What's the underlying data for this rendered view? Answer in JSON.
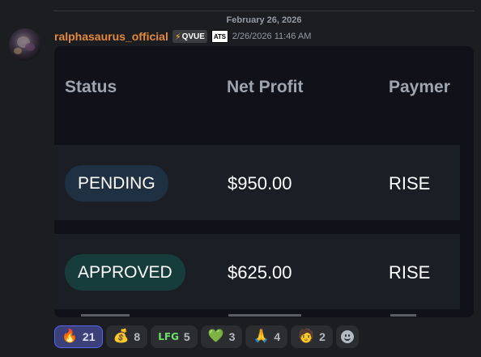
{
  "date_divider": "February 26, 2026",
  "message": {
    "username": "ralphasaurus_official",
    "tag_icon": "⚡",
    "tag_label": "QVUE",
    "badge": "ATS",
    "timestamp": "2/26/2026 11:46 AM"
  },
  "table": {
    "headers": [
      "Status",
      "Net Profit",
      "Paymer"
    ],
    "rows": [
      {
        "status": "PENDING",
        "net_profit": "$950.00",
        "payment": "RISE"
      },
      {
        "status": "APPROVED",
        "net_profit": "$625.00",
        "payment": "RISE"
      }
    ]
  },
  "reactions": [
    {
      "icon": "fire-emoji",
      "glyph": "🔥",
      "count": "21",
      "me": true
    },
    {
      "icon": "money-bag-emoji",
      "glyph": "💰",
      "count": "8",
      "me": false
    },
    {
      "icon": "lfg-emoji",
      "glyph": "LFG",
      "count": "5",
      "me": false
    },
    {
      "icon": "green-gem-emoji",
      "glyph": "💚",
      "count": "3",
      "me": false
    },
    {
      "icon": "praying-hands-emoji",
      "glyph": "🙏",
      "count": "4",
      "me": false
    },
    {
      "icon": "person-face-emoji",
      "glyph": "🧑",
      "count": "2",
      "me": false
    }
  ],
  "colors": {
    "username": "#e3893b",
    "accent": "#5865f2",
    "pending_pill": "#1f3042",
    "approved_pill": "#163c3c"
  }
}
